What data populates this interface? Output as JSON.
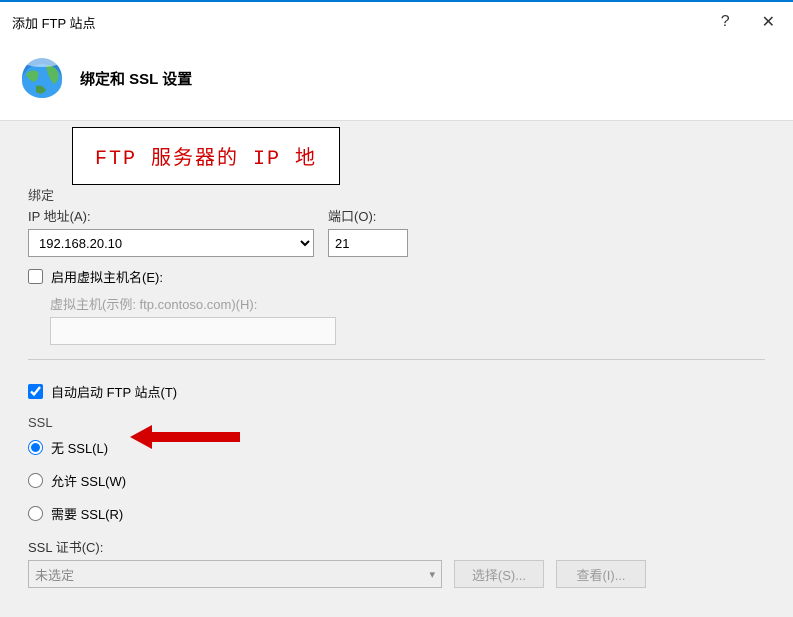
{
  "titlebar": {
    "title": "添加 FTP 站点",
    "help": "?",
    "close": "✕"
  },
  "header": {
    "title": "绑定和 SSL 设置"
  },
  "annotation": {
    "text": "FTP 服务器的 IP 地"
  },
  "binding": {
    "legend": "绑定",
    "ip_label": "IP 地址(A):",
    "ip_value": "192.168.20.10",
    "port_label": "端口(O):",
    "port_value": "21",
    "virtual_host_enable": "启用虚拟主机名(E):",
    "virtual_host_label": "虚拟主机(示例: ftp.contoso.com)(H):"
  },
  "autostart": {
    "label": "自动启动 FTP 站点(T)"
  },
  "ssl": {
    "legend": "SSL",
    "no_ssl": "无 SSL(L)",
    "allow_ssl": "允许 SSL(W)",
    "require_ssl": "需要 SSL(R)",
    "cert_label": "SSL 证书(C):",
    "cert_value": "未选定",
    "select_btn": "选择(S)...",
    "view_btn": "查看(I)..."
  }
}
